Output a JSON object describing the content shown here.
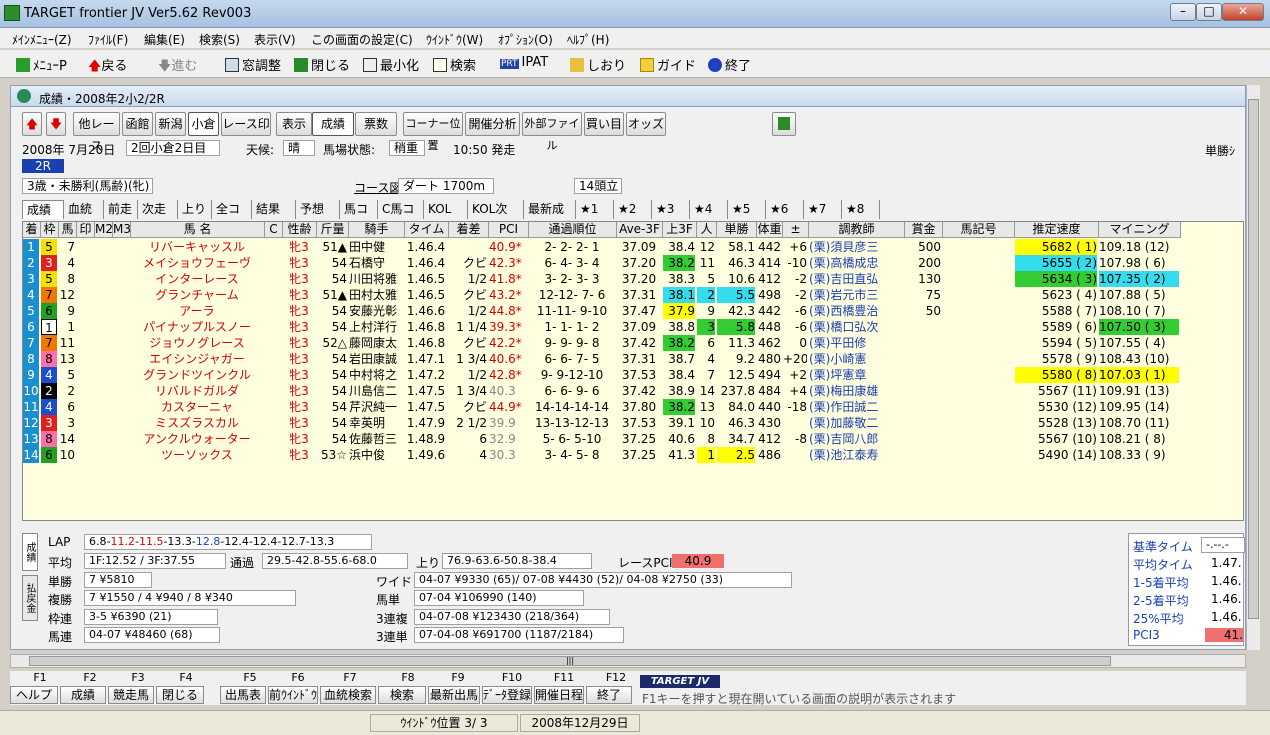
{
  "app": {
    "title": "TARGET frontier JV  Ver5.62  Rev003"
  },
  "menu": [
    "ﾒｲﾝﾒﾆｭｰ(Z)",
    "ﾌｧｲﾙ(F)",
    "編集(E)",
    "検索(S)",
    "表示(V)",
    "この画面の設定(C)",
    "ｳｲﾝﾄﾞｳ(W)",
    "ｵﾌﾟｼｮﾝ(O)",
    "ﾍﾙﾌﾟ(H)"
  ],
  "toolbar": {
    "menu": "ﾒﾆｭｰP",
    "back": "戻る",
    "forward": "進む",
    "window_adjust": "窓調整",
    "close": "閉じる",
    "minimize": "最小化",
    "search": "検索",
    "ipat": "IPAT",
    "bookmark": "しおり",
    "guide": "ガイド",
    "exit": "終了",
    "ipat_badge": "PRT"
  },
  "inner": {
    "title": "成績・2008年2小2/2R"
  },
  "btnrow": [
    "他レース",
    "函館",
    "新潟",
    "小倉",
    "レース印",
    "表示",
    "成績",
    "票数",
    "コーナー位置",
    "開催分析",
    "外部ファイル",
    "買い目",
    "オッズ"
  ],
  "race": {
    "date": "2008年  7月20日",
    "meet": "2回小倉2日目",
    "weather_label": "天候:",
    "weather": "晴",
    "track_label": "馬場状態:",
    "track": "稍重",
    "post_time": "10:50 発走",
    "tansho_right": "単勝ｼ",
    "race_no": "2R",
    "condition": "3歳・未勝利(馬齢)(牝)",
    "course_label": "コース図",
    "course": "ダート 1700m",
    "runners": "14頭立"
  },
  "tabs": [
    "成績",
    "血統他",
    "前走",
    "次走",
    "上り",
    "全コメ",
    "結果コメ",
    "予想コメ",
    "馬コメ",
    "C馬コメ",
    "KOLコメ",
    "KOL次メモ",
    "最新成績",
    "★1",
    "★2",
    "★3",
    "★4",
    "★5",
    "★6",
    "★7",
    "★8"
  ],
  "columns": [
    "着",
    "枠",
    "馬",
    "印",
    "M2",
    "M3",
    "馬 名",
    "C",
    "性齢",
    "斤量",
    "騎手",
    "タイム",
    "着差",
    "PCI",
    "通過順位",
    "Ave-3F",
    "上3F",
    "人",
    "単勝",
    "体重",
    "±",
    "調教師",
    "賞金",
    "馬記号",
    "推定速度",
    "マイニング"
  ],
  "rows": [
    {
      "pos": "1",
      "waku": "5",
      "num": "7",
      "name": "リバーキャッスル",
      "sex": "牝3",
      "wt": "51▲",
      "jockey": "田中健",
      "time": "1.46.4",
      "margin": "",
      "pci": "40.9*",
      "pass": "2- 2- 2- 1",
      "ave": "37.09",
      "l3f": "38.4",
      "pop": "12",
      "odds": "58.1",
      "bw": "442",
      "diff": "+6",
      "trainer": "(栗)須貝彦三",
      "prize": "500",
      "speed": "5682 ( 1)",
      "mining": "109.18 (12)"
    },
    {
      "pos": "2",
      "waku": "3",
      "num": "4",
      "name": "メイショウフェーヴ",
      "sex": "牝3",
      "wt": "54",
      "jockey": "石橋守",
      "time": "1.46.4",
      "margin": "クビ",
      "pci": "42.3*",
      "pass": "6- 4- 3- 4",
      "ave": "37.20",
      "l3f": "38.2",
      "pop": "11",
      "odds": "46.3",
      "bw": "414",
      "diff": "-10",
      "trainer": "(栗)高橋成忠",
      "prize": "200",
      "speed": "5655 ( 2)",
      "mining": "107.98 ( 6)"
    },
    {
      "pos": "3",
      "waku": "5",
      "num": "8",
      "name": "インターレース",
      "sex": "牝3",
      "wt": "54",
      "jockey": "川田将雅",
      "time": "1.46.5",
      "margin": "1/2",
      "pci": "41.8*",
      "pass": "3- 2- 3- 3",
      "ave": "37.20",
      "l3f": "38.3",
      "pop": "5",
      "odds": "10.6",
      "bw": "412",
      "diff": "-2",
      "trainer": "(栗)吉田直弘",
      "prize": "130",
      "speed": "5634 ( 3)",
      "mining": "107.35 ( 2)"
    },
    {
      "pos": "4",
      "waku": "7",
      "num": "12",
      "name": "グランチャーム",
      "sex": "牝3",
      "wt": "51▲",
      "jockey": "田村太雅",
      "time": "1.46.5",
      "margin": "クビ",
      "pci": "43.2*",
      "pass": "12-12- 7- 6",
      "ave": "37.31",
      "l3f": "38.1",
      "pop": "2",
      "odds": "5.5",
      "bw": "498",
      "diff": "-2",
      "trainer": "(栗)岩元市三",
      "prize": "75",
      "speed": "5623 ( 4)",
      "mining": "107.88 ( 5)"
    },
    {
      "pos": "5",
      "waku": "6",
      "num": "9",
      "name": "アーラ",
      "sex": "牝3",
      "wt": "54",
      "jockey": "安藤光彰",
      "time": "1.46.6",
      "margin": "1/2",
      "pci": "44.8*",
      "pass": "11-11- 9-10",
      "ave": "37.47",
      "l3f": "37.9",
      "pop": "9",
      "odds": "42.3",
      "bw": "442",
      "diff": "-6",
      "trainer": "(栗)西橋豊治",
      "prize": "50",
      "speed": "5588 ( 7)",
      "mining": "108.10 ( 7)"
    },
    {
      "pos": "6",
      "waku": "1",
      "num": "1",
      "name": "パイナップルスノー",
      "sex": "牝3",
      "wt": "54",
      "jockey": "上村洋行",
      "time": "1.46.8",
      "margin": "1 1/4",
      "pci": "39.3*",
      "pass": "1- 1- 1- 2",
      "ave": "37.09",
      "l3f": "38.8",
      "pop": "3",
      "odds": "5.8",
      "bw": "448",
      "diff": "-6",
      "trainer": "(栗)橋口弘次",
      "prize": "",
      "speed": "5589 ( 6)",
      "mining": "107.50 ( 3)"
    },
    {
      "pos": "7",
      "waku": "7",
      "num": "11",
      "name": "ジョウノグレース",
      "sex": "牝3",
      "wt": "52△",
      "jockey": "藤岡康太",
      "time": "1.46.8",
      "margin": "クビ",
      "pci": "42.2*",
      "pass": "9- 9- 9- 8",
      "ave": "37.42",
      "l3f": "38.2",
      "pop": "6",
      "odds": "11.3",
      "bw": "462",
      "diff": "0",
      "trainer": "(栗)平田修",
      "prize": "",
      "speed": "5594 ( 5)",
      "mining": "107.55 ( 4)"
    },
    {
      "pos": "8",
      "waku": "8",
      "num": "13",
      "name": "エイシンジャガー",
      "sex": "牝3",
      "wt": "54",
      "jockey": "岩田康誠",
      "time": "1.47.1",
      "margin": "1 3/4",
      "pci": "40.6*",
      "pass": "6- 6- 7- 5",
      "ave": "37.31",
      "l3f": "38.7",
      "pop": "4",
      "odds": "9.2",
      "bw": "480",
      "diff": "+20",
      "trainer": "(栗)小崎憲",
      "prize": "",
      "speed": "5578 ( 9)",
      "mining": "108.43 (10)"
    },
    {
      "pos": "9",
      "waku": "4",
      "num": "5",
      "name": "グランドツインクル",
      "sex": "牝3",
      "wt": "54",
      "jockey": "中村将之",
      "time": "1.47.2",
      "margin": "1/2",
      "pci": "42.8*",
      "pass": "9- 9-12-10",
      "ave": "37.53",
      "l3f": "38.4",
      "pop": "7",
      "odds": "12.5",
      "bw": "494",
      "diff": "+2",
      "trainer": "(栗)坪憲章",
      "prize": "",
      "speed": "5580 ( 8)",
      "mining": "107.03 ( 1)"
    },
    {
      "pos": "10",
      "waku": "2",
      "num": "2",
      "name": "リバルドガルダ",
      "sex": "牝3",
      "wt": "54",
      "jockey": "川島信二",
      "time": "1.47.5",
      "margin": "1 3/4",
      "pci": "40.3",
      "pass": "6- 6- 9- 6",
      "ave": "37.42",
      "l3f": "38.9",
      "pop": "14",
      "odds": "237.8",
      "bw": "484",
      "diff": "+4",
      "trainer": "(栗)梅田康雄",
      "prize": "",
      "speed": "5567 (11)",
      "mining": "109.91 (13)"
    },
    {
      "pos": "11",
      "waku": "4",
      "num": "6",
      "name": "カスターニャ",
      "sex": "牝3",
      "wt": "54",
      "jockey": "芹沢純一",
      "time": "1.47.5",
      "margin": "クビ",
      "pci": "44.9*",
      "pass": "14-14-14-14",
      "ave": "37.80",
      "l3f": "38.2",
      "pop": "13",
      "odds": "84.0",
      "bw": "440",
      "diff": "-18",
      "trainer": "(栗)作田誠二",
      "prize": "",
      "speed": "5530 (12)",
      "mining": "109.95 (14)"
    },
    {
      "pos": "12",
      "waku": "3",
      "num": "3",
      "name": "ミスズラスカル",
      "sex": "牝3",
      "wt": "54",
      "jockey": "幸英明",
      "time": "1.47.9",
      "margin": "2 1/2",
      "pci": "39.9",
      "pass": "13-13-12-13",
      "ave": "37.53",
      "l3f": "39.1",
      "pop": "10",
      "odds": "46.3",
      "bw": "430",
      "diff": "",
      "trainer": "(栗)加藤敬二",
      "prize": "",
      "speed": "5528 (13)",
      "mining": "108.70 (11)"
    },
    {
      "pos": "13",
      "waku": "8",
      "num": "14",
      "name": "アンクルウォーター",
      "sex": "牝3",
      "wt": "54",
      "jockey": "佐藤哲三",
      "time": "1.48.9",
      "margin": "6",
      "pci": "32.9",
      "pass": "5- 6- 5-10",
      "ave": "37.25",
      "l3f": "40.6",
      "pop": "8",
      "odds": "34.7",
      "bw": "412",
      "diff": "-8",
      "trainer": "(栗)吉岡八郎",
      "prize": "",
      "speed": "5567 (10)",
      "mining": "108.21 ( 8)"
    },
    {
      "pos": "14",
      "waku": "6",
      "num": "10",
      "name": "ツーソックス",
      "sex": "牝3",
      "wt": "53☆",
      "jockey": "浜中俊",
      "time": "1.49.6",
      "margin": "4",
      "pci": "30.3",
      "pass": "3- 4- 5- 8",
      "ave": "37.25",
      "l3f": "41.3",
      "pop": "1",
      "odds": "2.5",
      "bw": "486",
      "diff": "",
      "trainer": "(栗)池江泰寿",
      "prize": "",
      "speed": "5490 (14)",
      "mining": "108.33 ( 9)"
    }
  ],
  "lower": {
    "side_tab1": "成績",
    "side_tab2": "払戻金",
    "lap_label": "LAP",
    "lap_a": "6.8-",
    "lap_b": "11.2",
    "lap_c": "-",
    "lap_d": "11.5",
    "lap_e": "-13.3-",
    "lap_f": "12.8",
    "lap_g": "-12.4-12.4-12.7-13.3",
    "avg_label": "平均",
    "avg": "1F:12.52 / 3F:37.55",
    "pass_label": "通過",
    "pass": "29.5-42.8-55.6-68.0",
    "agari_label": "上り",
    "agari": "76.9-63.6-50.8-38.4",
    "pci_label": "レースPCI",
    "pci": "40.9",
    "tansho_label": "単勝",
    "tansho": "7 ¥5810",
    "fukusho_label": "複勝",
    "fukusho": "7 ¥1550 / 4 ¥940 / 8 ¥340",
    "wakuren_label": "枠連",
    "wakuren": "3-5 ¥6390 (21)",
    "umaren_label": "馬連",
    "umaren": "04-07 ¥48460 (68)",
    "wide_label": "ワイド",
    "wide": "04-07 ¥9330 (65)/ 07-08 ¥4430 (52)/ 04-08 ¥2750 (33)",
    "umatan_label": "馬単",
    "umatan": "07-04 ¥106990 (140)",
    "sanfuku_label": "3連複",
    "sanfuku": "04-07-08 ¥123430 (218/364)",
    "santan_label": "3連単",
    "santan": "07-04-08 ¥691700 (1187/2184)"
  },
  "side_panel": {
    "std_label": "基準タイム",
    "std": "-.--.-",
    "avg_label": "平均タイム",
    "avg": "1.47.",
    "top5_label": "1-5着平均",
    "top5": "1.46.",
    "r25_label": "2-5着平均",
    "r25": "1.46.",
    "p25_label": "25%平均",
    "p25": "1.46.",
    "pci3_label": "PCI3",
    "pci3": "41."
  },
  "fkeys": [
    {
      "k": "F1",
      "label": "ヘルプ"
    },
    {
      "k": "F2",
      "label": "成績"
    },
    {
      "k": "F3",
      "label": "競走馬"
    },
    {
      "k": "F4",
      "label": "閉じる"
    },
    {
      "k": "F5",
      "label": "出馬表"
    },
    {
      "k": "F6",
      "label": "前ｳｲﾝﾄﾞｳ"
    },
    {
      "k": "F7",
      "label": "血統検索"
    },
    {
      "k": "F8",
      "label": "検索"
    },
    {
      "k": "F9",
      "label": "最新出馬"
    },
    {
      "k": "F10",
      "label": "ﾃﾞｰﾀ登録"
    },
    {
      "k": "F11",
      "label": "開催日程"
    },
    {
      "k": "F12",
      "label": "終了"
    }
  ],
  "brand": "TARGET JV",
  "help_text": "F1キーを押すと現在開いている画面の説明が表示されます",
  "status": {
    "window_pos": "ｳｲﾝﾄﾞｳ位置 3/ 3",
    "date": "2008年12月29日"
  },
  "colors": {
    "waku": [
      "#ffffff",
      "#ffffff",
      "#000000",
      "#e02020",
      "#1a4fd0",
      "#f2e200",
      "#22a022",
      "#f07800",
      "#ff6fa8"
    ],
    "highlight_green": "#33cc33",
    "highlight_yellow": "#ffff00",
    "highlight_cyan": "#33ddee",
    "red": "#d40000",
    "pci_red": "#f07070"
  }
}
